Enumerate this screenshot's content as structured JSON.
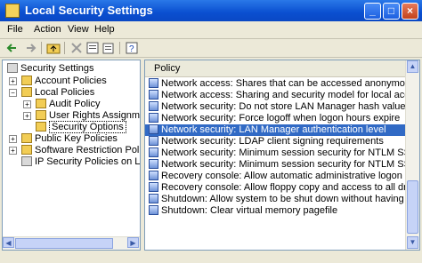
{
  "window": {
    "title": "Local Security Settings"
  },
  "menu": [
    "File",
    "Action",
    "View",
    "Help"
  ],
  "tree": {
    "root": "Security Settings",
    "items": [
      {
        "label": "Account Policies"
      },
      {
        "label": "Local Policies"
      },
      {
        "label": "Audit Policy"
      },
      {
        "label": "User Rights Assignment"
      },
      {
        "label": "Security Options"
      },
      {
        "label": "Public Key Policies"
      },
      {
        "label": "Software Restriction Policies"
      },
      {
        "label": "IP Security Policies on Local C"
      }
    ]
  },
  "list": {
    "column_header": "Policy",
    "selected_index": 5,
    "rows": [
      "Network access: Shares that can be accessed anonymously",
      "Network access: Sharing and security model for local accounts",
      "Network security: Do not store LAN Manager hash value on next p...",
      "Network security: Force logoff when logon hours expire",
      "Network security: LAN Manager authentication level",
      "Network security: LDAP client signing requirements",
      "Network security: Minimum session security for NTLM SSP based (i...",
      "Network security: Minimum session security for NTLM SSP based (i...",
      "Recovery console: Allow automatic administrative logon",
      "Recovery console: Allow floppy copy and access to all drives and all ...",
      "Shutdown: Allow system to be shut down without having to log on",
      "Shutdown: Clear virtual memory pagefile"
    ]
  }
}
